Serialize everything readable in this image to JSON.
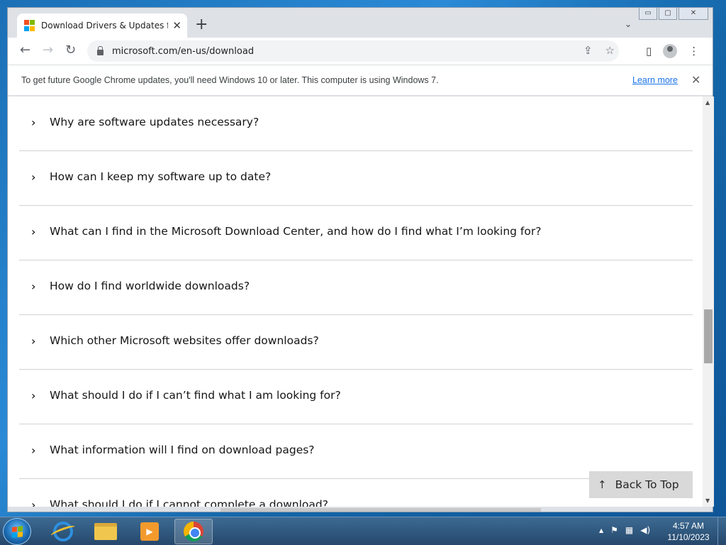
{
  "browser": {
    "tab_title": "Download Drivers & Updates for",
    "tab_close": "✕",
    "new_tab": "+",
    "tab_search": "⌄",
    "window_buttons": {
      "minimize": "▭",
      "maximize": "▢",
      "close": "✕"
    },
    "nav": {
      "back": "←",
      "forward": "→",
      "reload": "↻"
    },
    "url": "microsoft.com/en-us/download",
    "omnibox_icons": {
      "share": "⇪",
      "bookmark": "☆"
    },
    "toolbar_icons": {
      "side_panel": "▯",
      "menu": "⋮"
    }
  },
  "infobar": {
    "text": "To get future Google Chrome updates, you'll need Windows 10 or later. This computer is using Windows 7.",
    "link": "Learn more",
    "close": "✕"
  },
  "faq": {
    "chevron": "›",
    "items": [
      {
        "question": "Why are software updates necessary?"
      },
      {
        "question": "How can I keep my software up to date?"
      },
      {
        "question": "What can I find in the Microsoft Download Center, and how do I find what I’m looking for?"
      },
      {
        "question": "How do I find worldwide downloads?"
      },
      {
        "question": "Which other Microsoft websites offer downloads?"
      },
      {
        "question": "What should I do if I can’t find what I am looking for?"
      },
      {
        "question": "What information will I find on download pages?"
      },
      {
        "question": "What should I do if I cannot complete a download?"
      }
    ]
  },
  "back_to_top": {
    "arrow": "↑",
    "label": "Back To Top"
  },
  "scrollbar": {
    "up": "▲",
    "down": "▼"
  },
  "taskbar": {
    "tray": {
      "up_arrow": "▲",
      "flag": "⚑",
      "network": "▦",
      "volume": "◀)"
    },
    "time": "4:57 AM",
    "date": "11/10/2023"
  },
  "colors": {
    "ms_red": "#f25022",
    "ms_green": "#7fba00",
    "ms_blue": "#00a4ef",
    "ms_yellow": "#ffb900",
    "link_blue": "#1a73e8"
  }
}
